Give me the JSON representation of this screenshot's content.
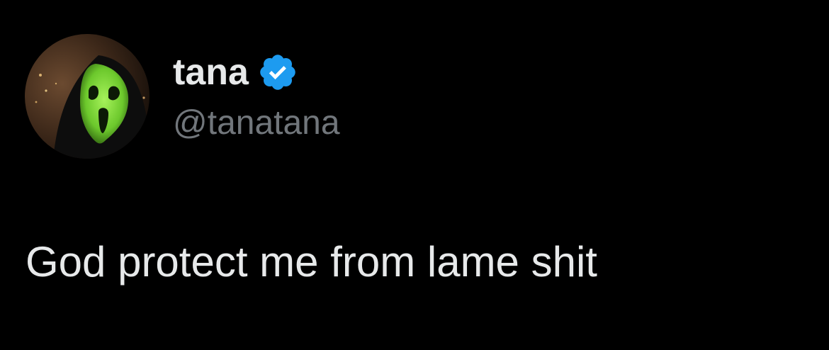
{
  "tweet": {
    "author": {
      "display_name": "tana",
      "handle": "@tanatana",
      "verified": true,
      "avatar_icon": "ghostface-mask-avatar"
    },
    "text": "God protect me from lame shit"
  },
  "colors": {
    "background": "#000000",
    "primary_text": "#e7e9ea",
    "secondary_text": "#71767b",
    "verified_badge": "#1d9bf0",
    "avatar_mask": "#7ddc3a"
  }
}
